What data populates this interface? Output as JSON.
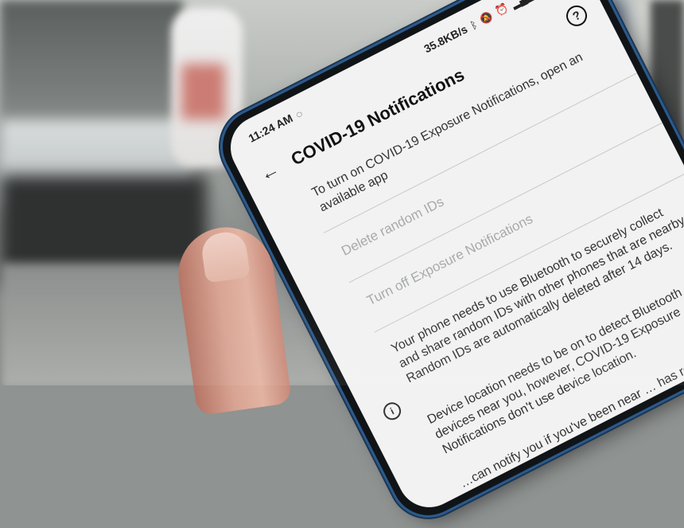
{
  "status_bar": {
    "time": "11:24 AM",
    "speed": "35.8KB/s",
    "battery": "100"
  },
  "app_bar": {
    "back_icon": "arrow-left-icon",
    "title": "COVID-19 Notifications",
    "help_icon": "question-circle-icon"
  },
  "content": {
    "turn_on_message": "To turn on COVID-19 Exposure Notifications, open an available app",
    "delete_ids": "Delete random IDs",
    "turn_off": "Turn off Exposure Notifications",
    "info_bluetooth": "Your phone needs to use Bluetooth to securely collect and share random IDs with other phones that are nearby. Random IDs are automatically deleted after 14 days.",
    "info_location": "Device location needs to be on to detect Bluetooth devices near you, however, COVID-19 Exposure Notifications don't use device location.",
    "info_notify": "…can notify you if you've been near … has reported a positive … signal strength … be shared"
  },
  "colors": {
    "screen_bg": "#f1f2f1",
    "disabled_text": "#a8aaa9",
    "phone_frame_accent": "#2c5a8b"
  }
}
